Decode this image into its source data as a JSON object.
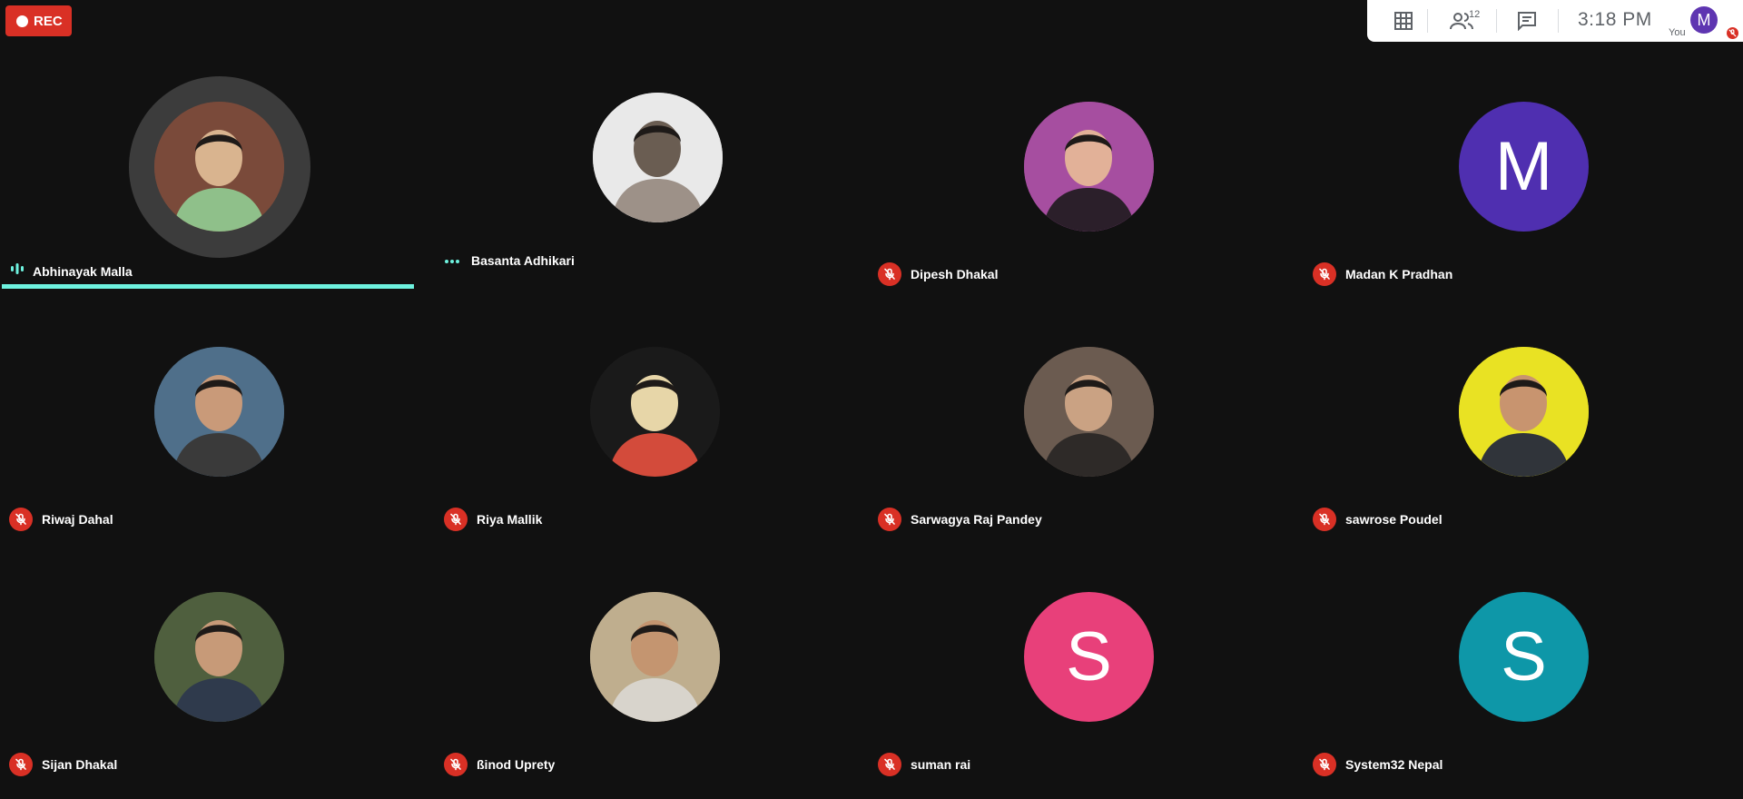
{
  "recording": {
    "label": "REC"
  },
  "topbar": {
    "icons": [
      "grid-view-icon",
      "people-icon",
      "chat-icon"
    ],
    "participant_count": "12",
    "time": "3:18  PM",
    "you_initial": "M",
    "you_label": "You",
    "you_avatar_color": "#5e35b1"
  },
  "colors": {
    "muted": "#d93025",
    "speaking": "#6ef2df",
    "background": "#111111"
  },
  "participants": [
    {
      "name": "Abhinayak Malla",
      "avatar": "photo",
      "status": "speaking"
    },
    {
      "name": "Basanta Adhikari",
      "avatar": "photo",
      "status": "connecting"
    },
    {
      "name": "Dipesh Dhakal",
      "avatar": "photo",
      "status": "muted"
    },
    {
      "name": "Madan K Pradhan",
      "avatar": "M",
      "avatar_color": "#4f2fb0",
      "status": "muted"
    },
    {
      "name": "Riwaj Dahal",
      "avatar": "photo",
      "status": "muted"
    },
    {
      "name": "Riya Mallik",
      "avatar": "photo",
      "status": "muted"
    },
    {
      "name": "Sarwagya Raj Pandey",
      "avatar": "photo",
      "status": "muted"
    },
    {
      "name": "sawrose Poudel",
      "avatar": "photo",
      "status": "muted"
    },
    {
      "name": "Sijan Dhakal",
      "avatar": "photo",
      "status": "muted"
    },
    {
      "name": "ßinod Uprety",
      "avatar": "photo",
      "status": "muted"
    },
    {
      "name": "suman rai",
      "avatar": "S",
      "avatar_color": "#e8407a",
      "status": "muted"
    },
    {
      "name": "System32 Nepal",
      "avatar": "S",
      "avatar_color": "#0e97a8",
      "status": "muted"
    }
  ]
}
